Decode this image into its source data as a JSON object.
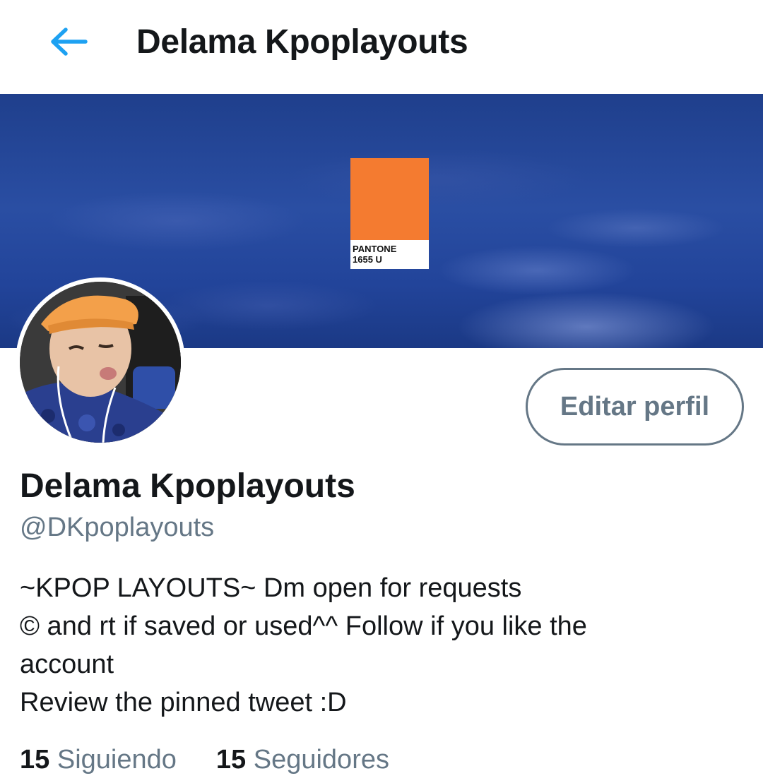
{
  "header": {
    "back_icon": "arrow-left-icon",
    "title": "Delama Kpoplayouts"
  },
  "banner": {
    "pantone_line1": "PANTONE",
    "pantone_line2": "1655 U",
    "swatch_color": "#f47b30"
  },
  "profile": {
    "edit_button_label": "Editar perfil",
    "display_name": "Delama Kpoplayouts",
    "handle": "@DKpoplayouts",
    "bio_lines": [
      "~KPOP LAYOUTS~ Dm open for requests",
      "© and rt if saved or used^^ Follow if you like the",
      "account",
      "Review the pinned tweet :D"
    ]
  },
  "stats": {
    "following_count": "15",
    "following_label": "Siguiendo",
    "followers_count": "15",
    "followers_label": "Seguidores"
  },
  "colors": {
    "accent": "#1da1f2",
    "secondary_text": "#657786",
    "primary_text": "#14171a"
  }
}
